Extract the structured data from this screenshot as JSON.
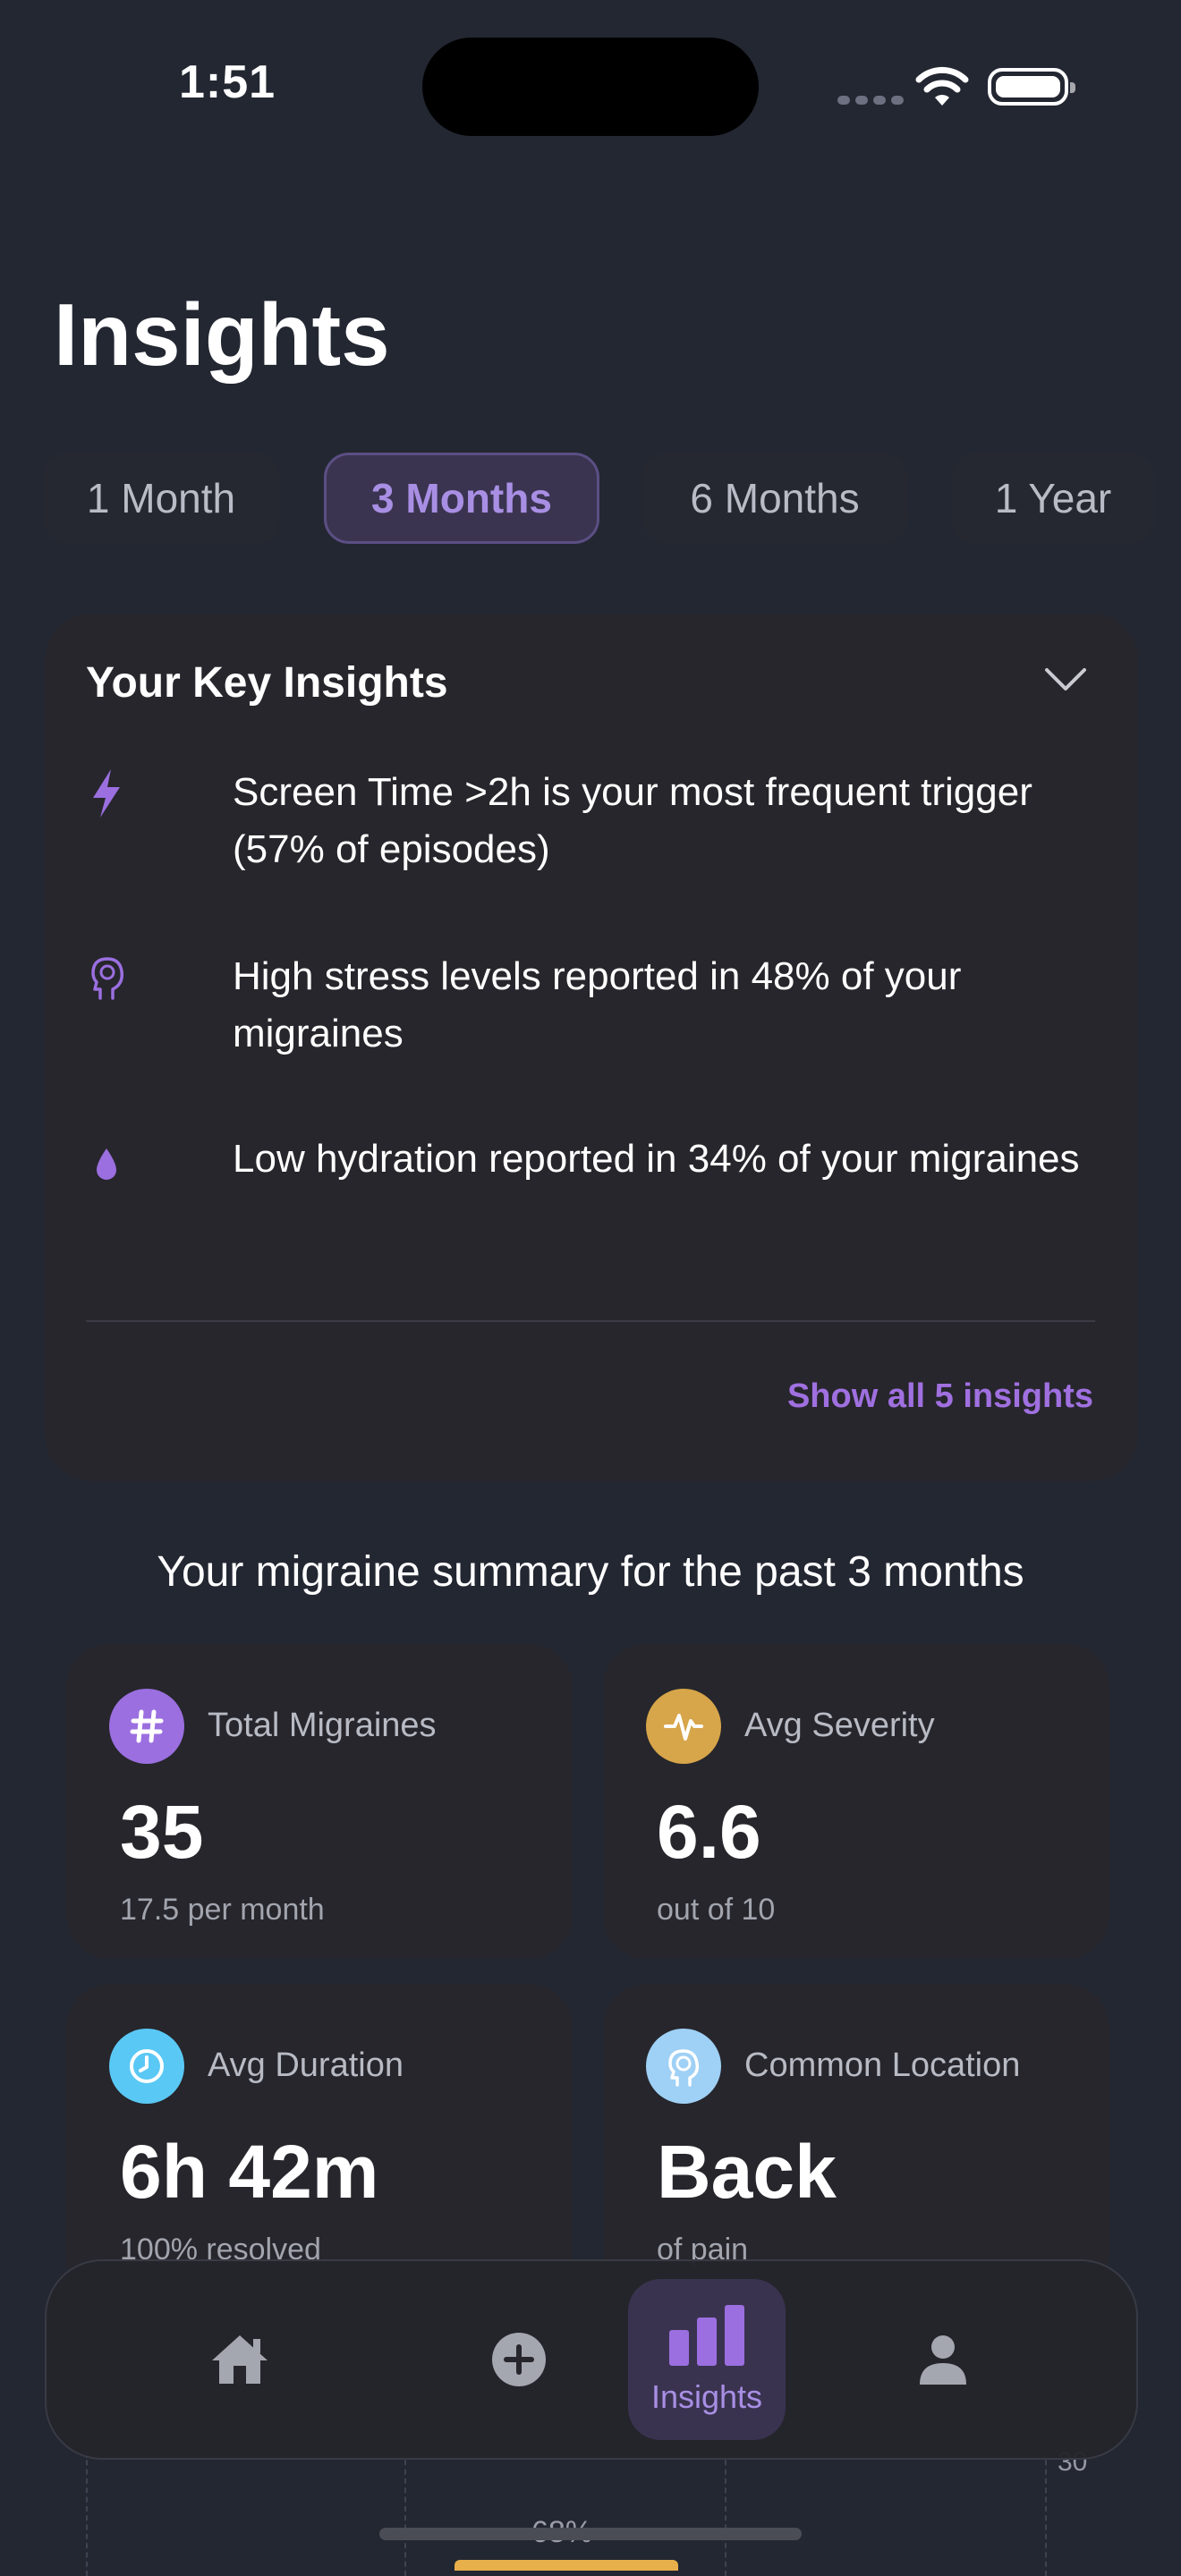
{
  "status_bar": {
    "time": "1:51"
  },
  "page": {
    "title": "Insights"
  },
  "range_tabs": [
    {
      "label": "1 Month",
      "active": false
    },
    {
      "label": "3 Months",
      "active": true
    },
    {
      "label": "6 Months",
      "active": false
    },
    {
      "label": "1 Year",
      "active": false
    }
  ],
  "key_insights": {
    "title": "Your Key Insights",
    "items": [
      {
        "icon": "bolt-icon",
        "text": "Screen Time >2h is your most frequent trigger (57% of episodes)"
      },
      {
        "icon": "head-brain-icon",
        "text": "High stress levels reported in 48% of your migraines"
      },
      {
        "icon": "water-drop-icon",
        "text": "Low hydration reported in 34% of your migraines"
      }
    ],
    "show_all": "Show all 5 insights"
  },
  "summary": {
    "title": "Your migraine summary for the past 3 months",
    "stats": [
      {
        "icon": "hash-icon",
        "color": "#9b6fe0",
        "label": "Total Migraines",
        "value": "35",
        "sub": "17.5 per month"
      },
      {
        "icon": "pulse-icon",
        "color": "#d7a54a",
        "label": "Avg Severity",
        "value": "6.6",
        "sub": "out of 10"
      },
      {
        "icon": "clock-icon",
        "color": "#5ac8f5",
        "label": "Avg Duration",
        "value": "6h 42m",
        "sub": "100% resolved"
      },
      {
        "icon": "head-brain-icon",
        "color": "#9fd0f5",
        "label": "Common Location",
        "value": "Back",
        "sub": "of pain"
      }
    ]
  },
  "chart_peek": {
    "tick": "30",
    "percent": "68%"
  },
  "bottom_nav": {
    "items": [
      {
        "icon": "home-icon",
        "label": ""
      },
      {
        "icon": "plus-circle-icon",
        "label": ""
      },
      {
        "icon": "bar-chart-icon",
        "label": "Insights",
        "active": true
      },
      {
        "icon": "person-icon",
        "label": ""
      }
    ]
  }
}
